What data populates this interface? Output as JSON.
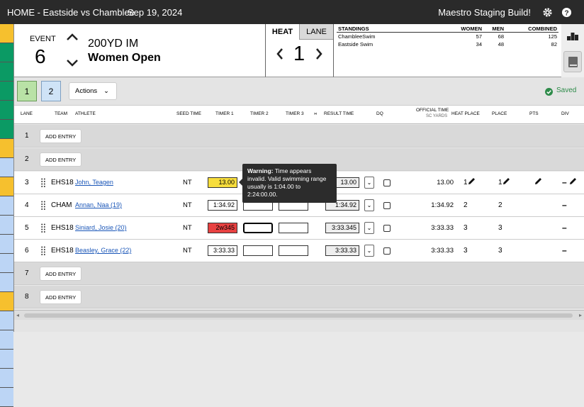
{
  "topbar": {
    "title": "HOME - Eastside vs Chamblee",
    "date": "Sep 19, 2024",
    "build": "Maestro Staging Build!",
    "settings_icon": "gear-icon",
    "help_icon": "help-icon"
  },
  "rail_colors": [
    "#f6c02e",
    "#0b9a64",
    "#0b9a64",
    "#0b9a64",
    "#0b9a64",
    "#0b9a64",
    "#f6c02e",
    "#bcd5f5",
    "#f6c02e",
    "#bcd5f5",
    "#bcd5f5",
    "#bcd5f5",
    "#bcd5f5",
    "#bcd5f5",
    "#f6c02e",
    "#bcd5f5",
    "#bcd5f5",
    "#bcd5f5",
    "#bcd5f5",
    "#bcd5f5"
  ],
  "event": {
    "label": "EVENT",
    "number": "6",
    "name": "200YD IM",
    "group": "Women Open"
  },
  "heat": {
    "tab_heat": "HEAT",
    "tab_lane": "LANE",
    "number": "1"
  },
  "standings": {
    "headers": [
      "STANDINGS",
      "WOMEN",
      "MEN",
      "COMBINED"
    ],
    "rows": [
      [
        "ChambleeSwim",
        "57",
        "68",
        "125"
      ],
      [
        "Eastside Swim",
        "34",
        "48",
        "82"
      ]
    ]
  },
  "toolbar": {
    "heat_buttons": [
      "1",
      "2"
    ],
    "actions_label": "Actions",
    "saved_label": "Saved"
  },
  "columns": {
    "lane": "LANE",
    "team": "TEAM",
    "athlete": "ATHLETE",
    "seed": "SEED TIME",
    "t1": "TIMER 1",
    "t2": "TIMER 2",
    "t3": "TIMER 3",
    "arrows": "›‹",
    "result": "RESULT TIME",
    "dq": "DQ",
    "official": "OFFICIAL TIME",
    "official_sub": "SC YARDS",
    "heat_place": "HEAT PLACE",
    "place": "PLACE",
    "pts": "PTS",
    "div": "DIV"
  },
  "add_entry": "ADD ENTRY",
  "empty_lanes": [
    {
      "lane": "1"
    },
    {
      "lane": "2"
    },
    {
      "lane": "7"
    },
    {
      "lane": "8"
    }
  ],
  "lanes": [
    {
      "lane": "3",
      "team": "EHS18",
      "athlete": "John, Teagen",
      "seed": "NT",
      "t1": "13.00",
      "t1_state": "warning",
      "result": "13.00",
      "official": "13.00",
      "heat_place": "1",
      "place": "1"
    },
    {
      "lane": "4",
      "team": "CHAM",
      "athlete": "Annan, Naa (19)",
      "seed": "NT",
      "t1": "1:34.92",
      "t1_state": "normal",
      "result": "1:34.92",
      "official": "1:34.92",
      "heat_place": "2",
      "place": "2"
    },
    {
      "lane": "5",
      "team": "EHS18",
      "athlete": "Siniard, Josie (20)",
      "seed": "NT",
      "t1": "2w345",
      "t1_state": "error",
      "result": "3:33.345",
      "official": "3:33.33",
      "heat_place": "3",
      "place": "3"
    },
    {
      "lane": "6",
      "team": "EHS18",
      "athlete": "Beasley, Grace (22)",
      "seed": "NT",
      "t1": "3:33.33",
      "t1_state": "normal",
      "result": "3:33.33",
      "official": "3:33.33",
      "heat_place": "3",
      "place": "3"
    }
  ],
  "tooltip": {
    "bold": "Warning:",
    "text": " Time appears invalid. Valid swimming range usually is 1:04.00 to 2:24:00.00."
  },
  "dash": "–"
}
